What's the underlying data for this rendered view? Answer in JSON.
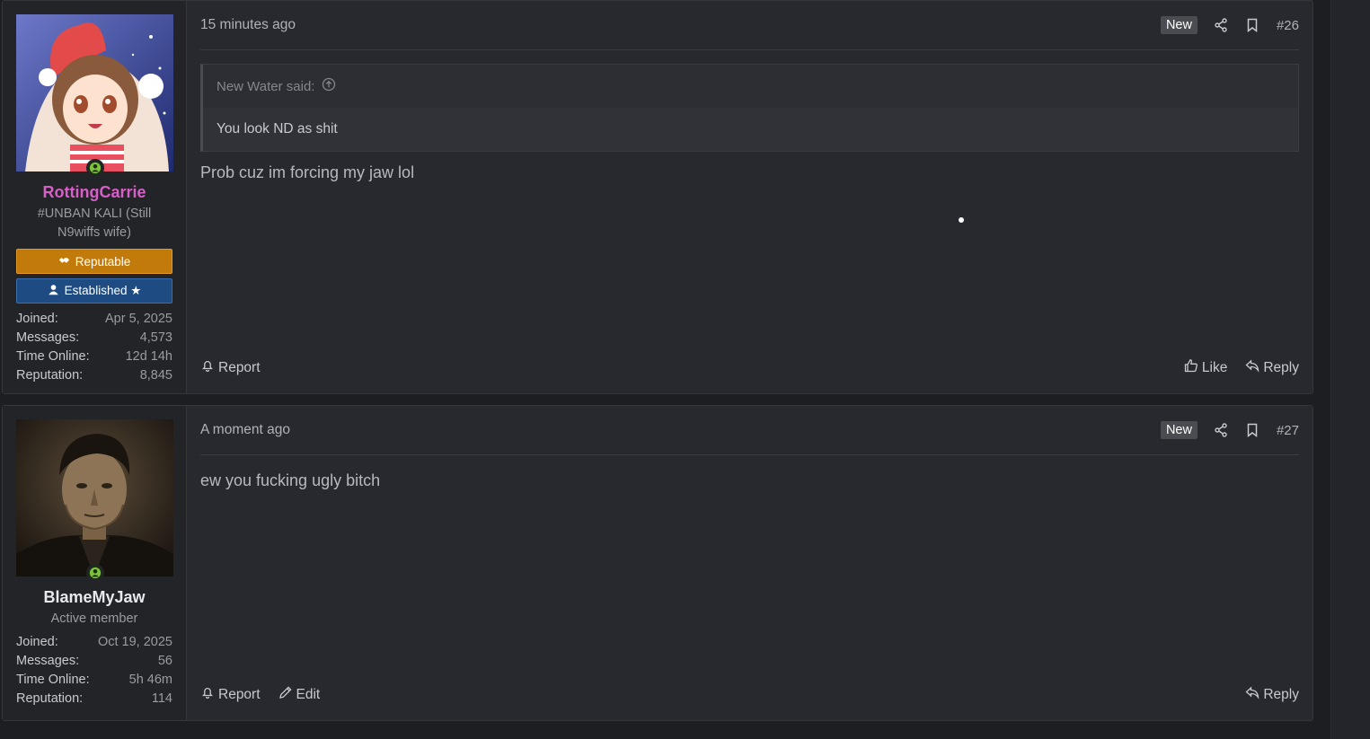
{
  "posts": [
    {
      "username": "RottingCarrie",
      "user_title": "#UNBAN KALI (Still N9wiffs wife)",
      "banners": [
        "Reputable",
        "Established ★"
      ],
      "stats": [
        {
          "label": "Joined:",
          "value": "Apr 5, 2025"
        },
        {
          "label": "Messages:",
          "value": "4,573"
        },
        {
          "label": "Time Online:",
          "value": "12d 14h"
        },
        {
          "label": "Reputation:",
          "value": "8,845"
        }
      ],
      "date": "15 minutes ago",
      "badge": "New",
      "number": "#26",
      "quote": {
        "author": "New Water said:",
        "text": "You look ND as shit"
      },
      "message": "Prob cuz im forcing my jaw lol",
      "actions": {
        "report": "Report",
        "like": "Like",
        "reply": "Reply"
      }
    },
    {
      "username": "BlameMyJaw",
      "user_title": "Active member",
      "stats": [
        {
          "label": "Joined:",
          "value": "Oct 19, 2025"
        },
        {
          "label": "Messages:",
          "value": "56"
        },
        {
          "label": "Time Online:",
          "value": "5h 46m"
        },
        {
          "label": "Reputation:",
          "value": "114"
        }
      ],
      "date": "A moment ago",
      "badge": "New",
      "number": "#27",
      "message": "ew you fucking ugly bitch",
      "actions": {
        "report": "Report",
        "edit": "Edit",
        "reply": "Reply"
      }
    }
  ],
  "colors": {
    "username_pink": "#d85ec8",
    "reputable_banner": "#c27b0a",
    "established_banner": "#1e4b82",
    "online_indicator": "#7cc33a"
  }
}
